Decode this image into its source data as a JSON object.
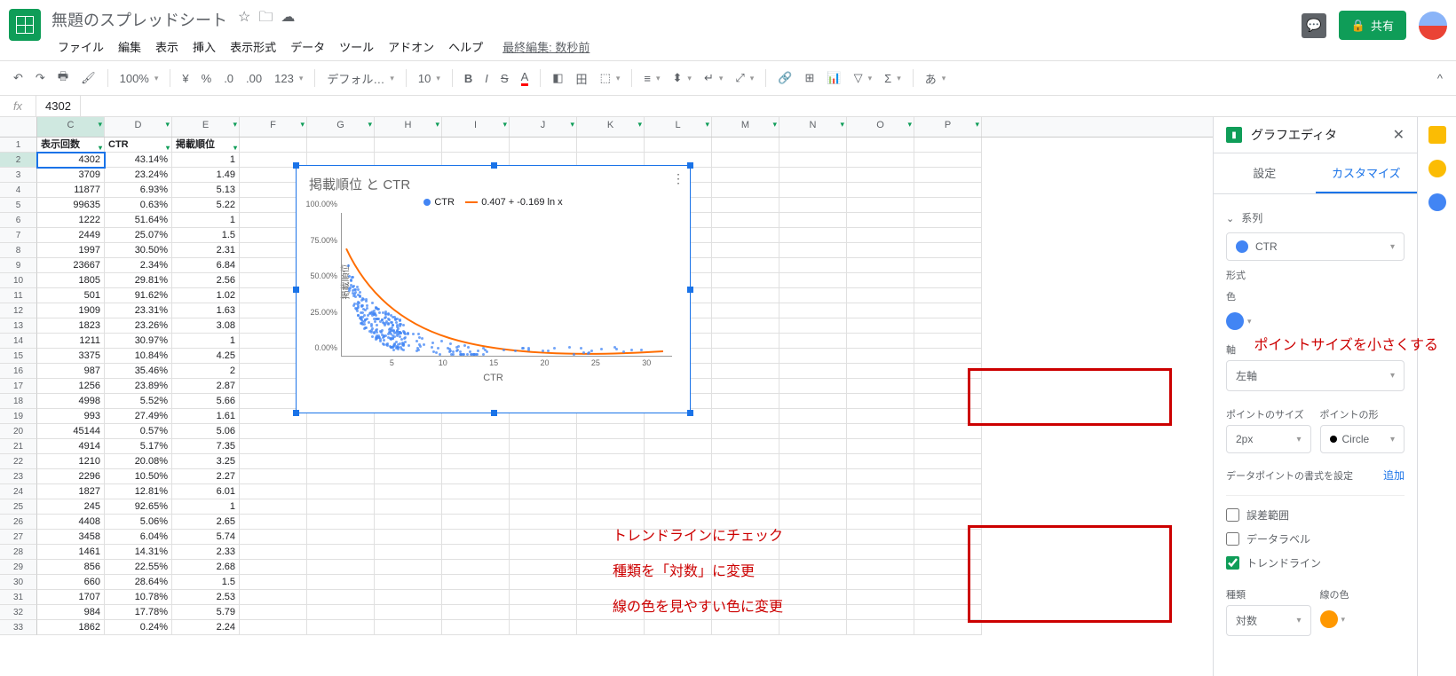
{
  "doc": {
    "title": "無題のスプレッドシート"
  },
  "menu": {
    "file": "ファイル",
    "edit": "編集",
    "view": "表示",
    "insert": "挿入",
    "format": "表示形式",
    "data": "データ",
    "tools": "ツール",
    "addons": "アドオン",
    "help": "ヘルプ",
    "last_edit": "最終編集: 数秒前"
  },
  "share": {
    "label": "共有"
  },
  "toolbar": {
    "zoom": "100%",
    "font": "デフォル…",
    "size": "10",
    "num_fmt": "123"
  },
  "fx": {
    "cell_value": "4302"
  },
  "columns": [
    "C",
    "D",
    "E",
    "F",
    "G",
    "H",
    "I",
    "J",
    "K",
    "L",
    "M",
    "N",
    "O",
    "P"
  ],
  "headers": {
    "c": "表示回数",
    "d": "CTR",
    "e": "掲載順位"
  },
  "rows": [
    {
      "c": "4302",
      "d": "43.14%",
      "e": "1"
    },
    {
      "c": "3709",
      "d": "23.24%",
      "e": "1.49"
    },
    {
      "c": "11877",
      "d": "6.93%",
      "e": "5.13"
    },
    {
      "c": "99635",
      "d": "0.63%",
      "e": "5.22"
    },
    {
      "c": "1222",
      "d": "51.64%",
      "e": "1"
    },
    {
      "c": "2449",
      "d": "25.07%",
      "e": "1.5"
    },
    {
      "c": "1997",
      "d": "30.50%",
      "e": "2.31"
    },
    {
      "c": "23667",
      "d": "2.34%",
      "e": "6.84"
    },
    {
      "c": "1805",
      "d": "29.81%",
      "e": "2.56"
    },
    {
      "c": "501",
      "d": "91.62%",
      "e": "1.02"
    },
    {
      "c": "1909",
      "d": "23.31%",
      "e": "1.63"
    },
    {
      "c": "1823",
      "d": "23.26%",
      "e": "3.08"
    },
    {
      "c": "1211",
      "d": "30.97%",
      "e": "1"
    },
    {
      "c": "3375",
      "d": "10.84%",
      "e": "4.25"
    },
    {
      "c": "987",
      "d": "35.46%",
      "e": "2"
    },
    {
      "c": "1256",
      "d": "23.89%",
      "e": "2.87"
    },
    {
      "c": "4998",
      "d": "5.52%",
      "e": "5.66"
    },
    {
      "c": "993",
      "d": "27.49%",
      "e": "1.61"
    },
    {
      "c": "45144",
      "d": "0.57%",
      "e": "5.06"
    },
    {
      "c": "4914",
      "d": "5.17%",
      "e": "7.35"
    },
    {
      "c": "1210",
      "d": "20.08%",
      "e": "3.25"
    },
    {
      "c": "2296",
      "d": "10.50%",
      "e": "2.27"
    },
    {
      "c": "1827",
      "d": "12.81%",
      "e": "6.01"
    },
    {
      "c": "245",
      "d": "92.65%",
      "e": "1"
    },
    {
      "c": "4408",
      "d": "5.06%",
      "e": "2.65"
    },
    {
      "c": "3458",
      "d": "6.04%",
      "e": "5.74"
    },
    {
      "c": "1461",
      "d": "14.31%",
      "e": "2.33"
    },
    {
      "c": "856",
      "d": "22.55%",
      "e": "2.68"
    },
    {
      "c": "660",
      "d": "28.64%",
      "e": "1.5"
    },
    {
      "c": "1707",
      "d": "10.78%",
      "e": "2.53"
    },
    {
      "c": "984",
      "d": "17.78%",
      "e": "5.79"
    },
    {
      "c": "1862",
      "d": "0.24%",
      "e": "2.24"
    }
  ],
  "chart": {
    "title": "掲載順位 と CTR",
    "legend_series": "CTR",
    "legend_trend": "0.407 + -0.169 ln x",
    "ylabel": "掲載順位",
    "xlabel": "CTR",
    "y_ticks": [
      "0.00%",
      "25.00%",
      "50.00%",
      "75.00%",
      "100.00%"
    ],
    "x_ticks": [
      "5",
      "10",
      "15",
      "20",
      "25",
      "30"
    ],
    "series_color": "#4285f4",
    "trend_color": "#ff6d00"
  },
  "chart_data": {
    "type": "scatter",
    "title": "掲載順位 と CTR",
    "xlabel": "CTR",
    "ylabel": "掲載順位",
    "xlim": [
      0,
      32
    ],
    "ylim": [
      0,
      1.0
    ],
    "series": [
      {
        "name": "CTR",
        "note": "dense scatter, ~300 points concentrated x<10 y<50%, long tail to x~30",
        "sample_points_x": [
          1,
          1,
          1,
          1.49,
          1.5,
          1.5,
          1.61,
          1.63,
          2,
          2.27,
          2.31,
          2.33,
          2.53,
          2.56,
          2.65,
          2.68,
          2.87,
          3.08,
          3.25,
          4.25,
          5.06,
          5.13,
          5.22,
          5.66,
          5.74,
          5.79,
          6.01,
          6.84,
          7.35
        ],
        "sample_points_y": [
          0.4314,
          0.5164,
          0.3097,
          0.2324,
          0.2507,
          0.2864,
          0.2749,
          0.2331,
          0.3546,
          0.105,
          0.305,
          0.1431,
          0.1078,
          0.2981,
          0.0506,
          0.2255,
          0.2389,
          0.2326,
          0.2008,
          0.1084,
          0.0057,
          0.0693,
          0.0063,
          0.0552,
          0.0604,
          0.1778,
          0.1281,
          0.0234,
          0.0517
        ]
      }
    ],
    "trendline": {
      "formula": "0.407 + -0.169 ln x",
      "color": "#ff6d00",
      "type": "logarithmic"
    }
  },
  "editor": {
    "title": "グラフエディタ",
    "tab_setup": "設定",
    "tab_customize": "カスタマイズ",
    "series_section": "系列",
    "series_value": "CTR",
    "format_label": "形式",
    "color_label": "色",
    "axis_label": "軸",
    "axis_value": "左軸",
    "point_size_label": "ポイントのサイズ",
    "point_size_value": "2px",
    "point_shape_label": "ポイントの形",
    "point_shape_value": "Circle",
    "datapoint_format": "データポイントの書式を設定",
    "add_link": "追加",
    "error_bars": "誤差範囲",
    "data_labels": "データラベル",
    "trendline": "トレンドライン",
    "type_label": "種類",
    "type_value": "対数",
    "line_color_label": "線の色",
    "series_color": "#4285f4",
    "line_color": "#ff9800"
  },
  "annotations": {
    "a1": "ポイントサイズを小さくする",
    "a2": "トレンドラインにチェック",
    "a3": "種類を「対数」に変更",
    "a4": "線の色を見やすい色に変更"
  }
}
